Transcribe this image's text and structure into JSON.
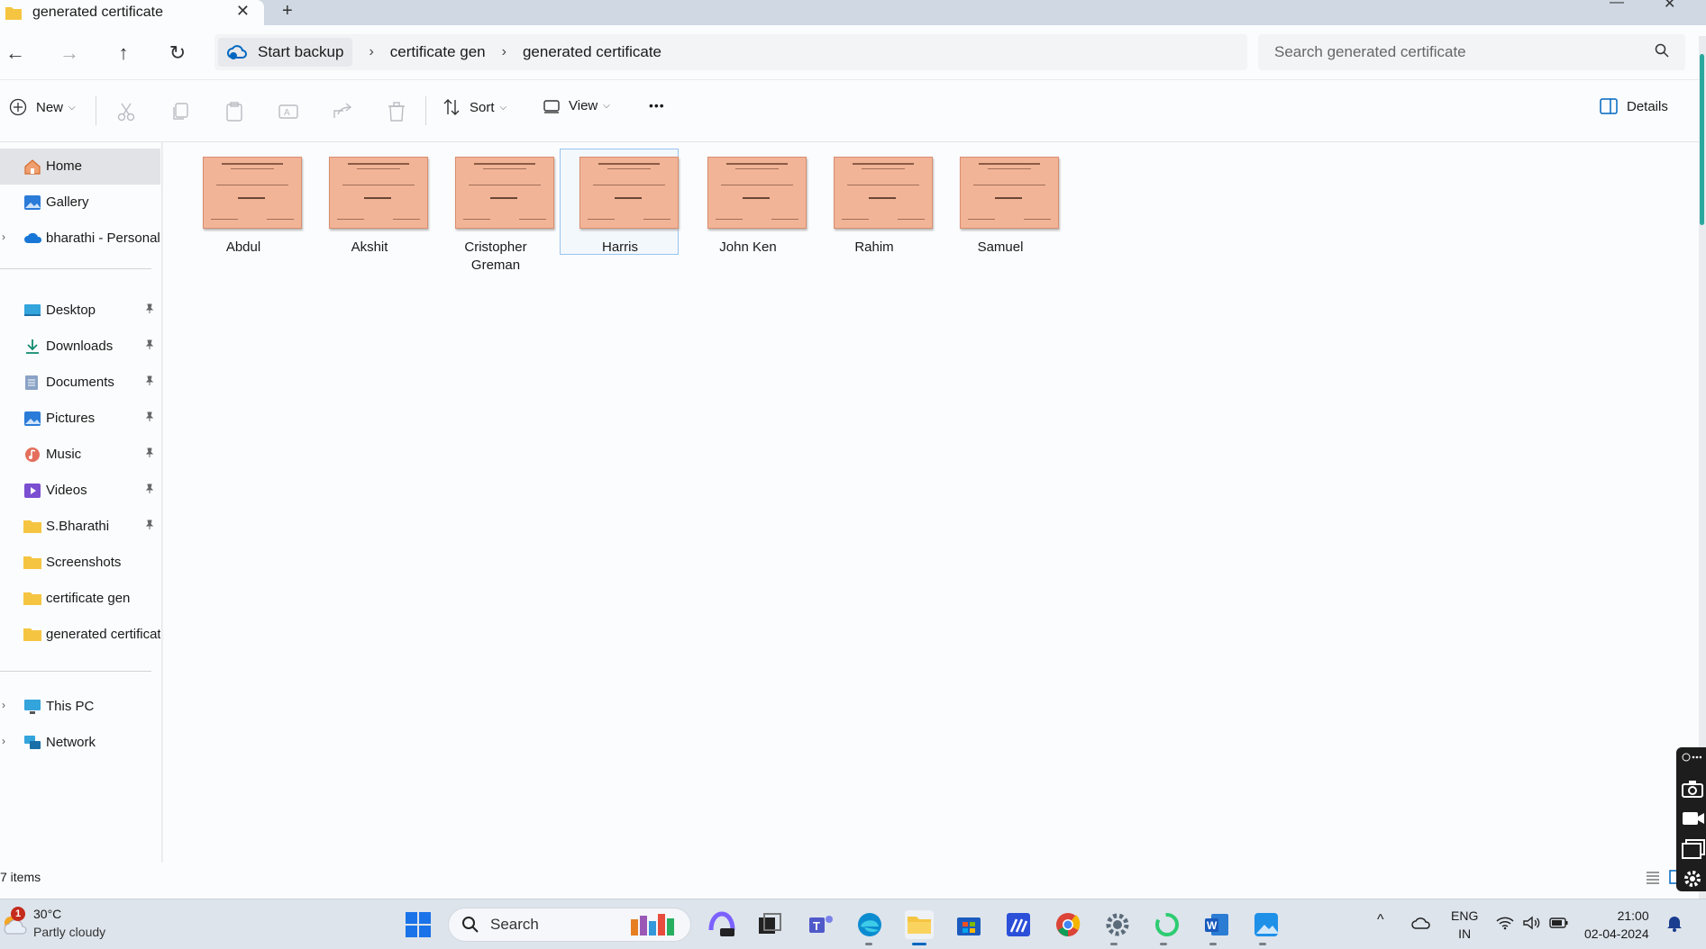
{
  "window": {
    "tab_title": "generated certificate",
    "tab_close": "✕",
    "tab_add": "+",
    "minimize": "—",
    "close": "✕"
  },
  "address": {
    "back": "←",
    "forward": "→",
    "up": "↑",
    "refresh": "↻",
    "backup_label": "Start backup",
    "breadcrumbs": [
      "certificate gen",
      "generated certificate"
    ],
    "separator": "›",
    "search_placeholder": "Search generated certificate"
  },
  "commands": {
    "new_label": "New",
    "sort_label": "Sort",
    "view_label": "View",
    "more_label": "•••",
    "details_label": "Details"
  },
  "sidebar": {
    "top": [
      {
        "label": "Home",
        "icon": "home-icon",
        "selected": true
      },
      {
        "label": "Gallery",
        "icon": "gallery-icon"
      },
      {
        "label": "bharathi - Personal",
        "icon": "onedrive-icon",
        "expandable": true
      }
    ],
    "pinned": [
      {
        "label": "Desktop",
        "icon": "desktop-icon"
      },
      {
        "label": "Downloads",
        "icon": "downloads-icon"
      },
      {
        "label": "Documents",
        "icon": "documents-icon"
      },
      {
        "label": "Pictures",
        "icon": "pictures-icon"
      },
      {
        "label": "Music",
        "icon": "music-icon"
      },
      {
        "label": "Videos",
        "icon": "videos-icon"
      },
      {
        "label": "S.Bharathi",
        "icon": "folder-icon"
      }
    ],
    "recent": [
      {
        "label": "Screenshots",
        "icon": "folder-icon"
      },
      {
        "label": "certificate gen",
        "icon": "folder-icon"
      },
      {
        "label": "generated certificat",
        "icon": "folder-icon"
      }
    ],
    "bottom": [
      {
        "label": "This PC",
        "icon": "pc-icon"
      },
      {
        "label": "Network",
        "icon": "network-icon"
      }
    ],
    "expand_glyph": "›"
  },
  "files": [
    {
      "name": "Abdul"
    },
    {
      "name": "Akshit"
    },
    {
      "name": "Cristopher Greman"
    },
    {
      "name": "Harris",
      "selected": true
    },
    {
      "name": "John Ken"
    },
    {
      "name": "Rahim"
    },
    {
      "name": "Samuel"
    }
  ],
  "status": {
    "item_count": "7 items"
  },
  "taskbar": {
    "weather_temp": "30°C",
    "weather_cond": "Partly cloudy",
    "weather_badge": "1",
    "search_label": "Search",
    "lang_1": "ENG",
    "lang_2": "IN",
    "time": "21:00",
    "date": "02-04-2024",
    "tray_chevron": "^"
  },
  "colors": {
    "accent": "#0067c0",
    "thumbnail": "#f2b497",
    "folder": "#f5c542",
    "scroll_thumb": "#2aa89d"
  }
}
